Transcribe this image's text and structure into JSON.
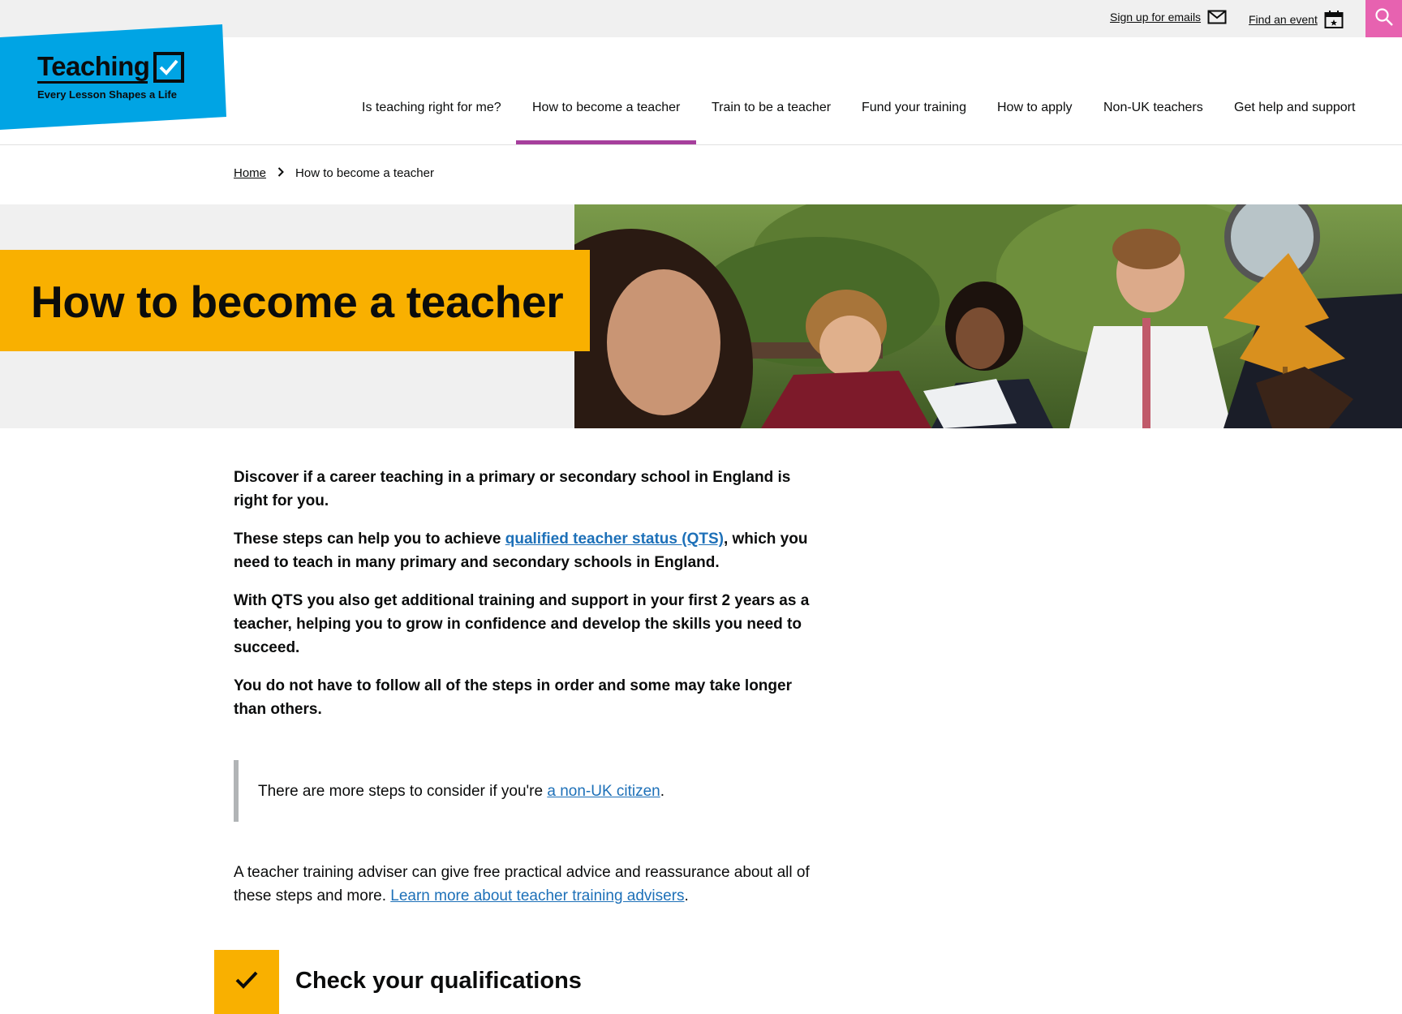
{
  "utility": {
    "emails_label": "Sign up for emails",
    "events_label": "Find an event",
    "search_icon": "search-icon"
  },
  "logo": {
    "word": "Teaching",
    "tagline": "Every Lesson Shapes a Life"
  },
  "nav": {
    "items": [
      {
        "label": "Is teaching right for me?"
      },
      {
        "label": "How to become a teacher",
        "active": true
      },
      {
        "label": "Train to be a teacher"
      },
      {
        "label": "Fund your training"
      },
      {
        "label": "How to apply"
      },
      {
        "label": "Non-UK teachers"
      },
      {
        "label": "Get help and support"
      }
    ]
  },
  "breadcrumb": {
    "home": "Home",
    "current": "How to become a teacher"
  },
  "hero": {
    "title": "How to become a teacher"
  },
  "intro": {
    "p1": "Discover if a career teaching in a primary or secondary school in England is right for you.",
    "p2_before": "These steps can help you to achieve ",
    "p2_link": "qualified teacher status (QTS)",
    "p2_after": ", which you need to teach in many primary and secondary schools in England.",
    "p3": "With QTS you also get additional training and support in your first 2 years as a teacher, helping you to grow in confidence and develop the skills you need to succeed.",
    "p4": "You do not have to follow all of the steps in order and some may take longer than others."
  },
  "inset": {
    "before": "There are more steps to consider if you're ",
    "link": "a non-UK citizen",
    "after": "."
  },
  "adviser": {
    "text": "A teacher training adviser can give free practical advice and reassurance about all of these steps and more. ",
    "link": "Learn more about teacher training advisers",
    "after": "."
  },
  "step": {
    "title": "Check your qualifications"
  },
  "colors": {
    "logo_blue": "#00a4e4",
    "yellow": "#f9b000",
    "pink": "#e762b0",
    "nav_active": "#a63f9c",
    "link": "#1d70b8"
  }
}
